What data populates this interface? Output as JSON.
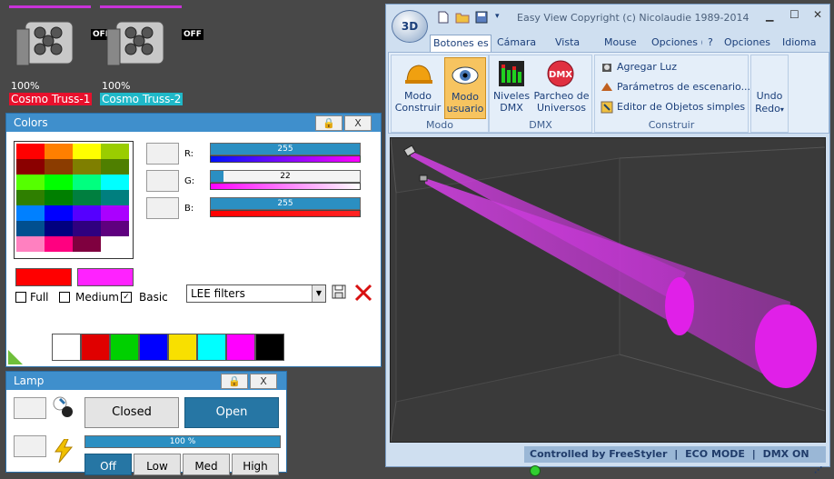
{
  "fixtures": [
    {
      "off_label": "OFF",
      "percent": "100%",
      "name": "Cosmo Truss-1",
      "name_bg": "#e8102c"
    },
    {
      "off_label": "OFF",
      "percent": "100%",
      "name": "Cosmo Truss-2",
      "name_bg": "#1fb8c8"
    }
  ],
  "colors_panel": {
    "title": "Colors",
    "lock_icon": "lock-icon",
    "close_label": "X",
    "palette": [
      [
        "#ff0000",
        "#ff7f00",
        "#ffff00",
        "#9acd00"
      ],
      [
        "#8b0000",
        "#8b3c00",
        "#7f7f00",
        "#4f7f00"
      ],
      [
        "#55ff00",
        "#00ff00",
        "#00ff7f",
        "#00ffff"
      ],
      [
        "#2f7f00",
        "#007f00",
        "#007f3f",
        "#007f7f"
      ],
      [
        "#0080ff",
        "#0000ff",
        "#5500ff",
        "#aa00ff"
      ],
      [
        "#004f8f",
        "#00007f",
        "#2f007f",
        "#5f007f"
      ],
      [
        "#ff80c0",
        "#ff0080",
        "#7f003f",
        "#ffffff"
      ]
    ],
    "r_label": "R:",
    "g_label": "G:",
    "b_label": "B:",
    "r_value": "255",
    "g_value": "22",
    "b_value": "255",
    "r_fraction": 1.0,
    "g_fraction": 0.086,
    "b_fraction": 1.0,
    "prev_color": "#ff0000",
    "cur_color": "#ff22ff",
    "full_label": "Full",
    "medium_label": "Medium",
    "basic_label": "Basic",
    "basic_checked": "✓",
    "filter_select": "LEE filters",
    "quick_colors": [
      "#ffffff",
      "#e00000",
      "#00d000",
      "#0000ff",
      "#f8e000",
      "#00ffff",
      "#ff00ff",
      "#000000"
    ]
  },
  "lamp_panel": {
    "title": "Lamp",
    "close_label": "X",
    "closed_label": "Closed",
    "open_label": "Open",
    "dimmer_value": "100 %",
    "dimmer_fraction": 1.0,
    "off_label": "Off",
    "low_label": "Low",
    "med_label": "Med",
    "high_label": "High"
  },
  "app": {
    "logo": "3D",
    "window_title": "Easy View  Copyright (c) Nicolaudie 1989-2014",
    "tabs": [
      "Botones es",
      "Cámara",
      "Vista",
      "Mouse",
      "Opciones ("
    ],
    "right_menus": [
      "?",
      "Opciones",
      "Idioma"
    ],
    "modo_construir": "Modo\nConstruir",
    "modo_usuario": "Modo\nusuario",
    "grp_modo": "Modo",
    "niveles_dmx": "Niveles\nDMX",
    "parcheo": "Parcheo de\nUniversos",
    "grp_dmx": "DMX",
    "agregar_luz": "Agregar Luz",
    "parametros": "Parámetros de escenario...",
    "editor": "Editor de Objetos simples",
    "grp_construir": "Construir",
    "redo": "Redo",
    "status_controlled": "Controlled by FreeStyler",
    "status_eco": "ECO MODE",
    "status_dmx": "DMX ON"
  }
}
